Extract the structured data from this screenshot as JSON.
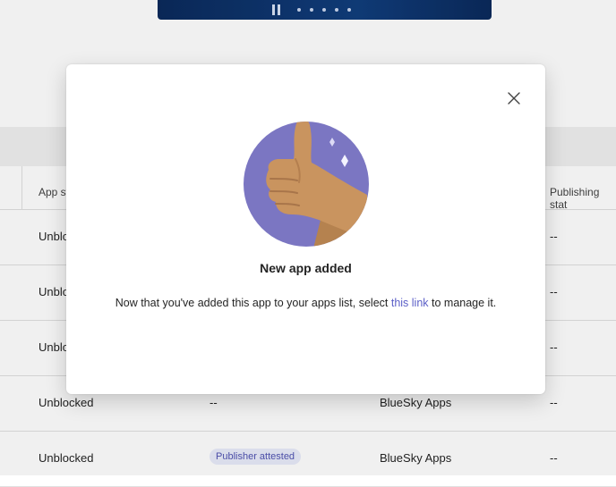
{
  "table": {
    "headers": [
      "App st",
      "Publishing stat"
    ],
    "rows": [
      {
        "status": "Unblo",
        "publisher": "",
        "vendor": "",
        "publishing": "--"
      },
      {
        "status": "Unblo",
        "publisher": "",
        "vendor": "",
        "publishing": "--"
      },
      {
        "status": "Unblo",
        "publisher": "",
        "vendor": "",
        "publishing": "--"
      },
      {
        "status": "Unblocked",
        "publisher": "--",
        "vendor": "BlueSky Apps",
        "publishing": "--"
      },
      {
        "status": "Unblocked",
        "publisher_badge": "Publisher attested",
        "vendor": "BlueSky Apps",
        "publishing": "--"
      }
    ]
  },
  "dialog": {
    "title": "New app added",
    "message_before": "Now that you've added this app to your apps list, select ",
    "link_text": "this link",
    "message_after": " to manage it.",
    "close_icon": "close-icon",
    "illustration": "thumbs-up-icon",
    "colors": {
      "circle": "#7b76c2",
      "hand": "#c9945f",
      "link": "#5b5fc7"
    }
  }
}
